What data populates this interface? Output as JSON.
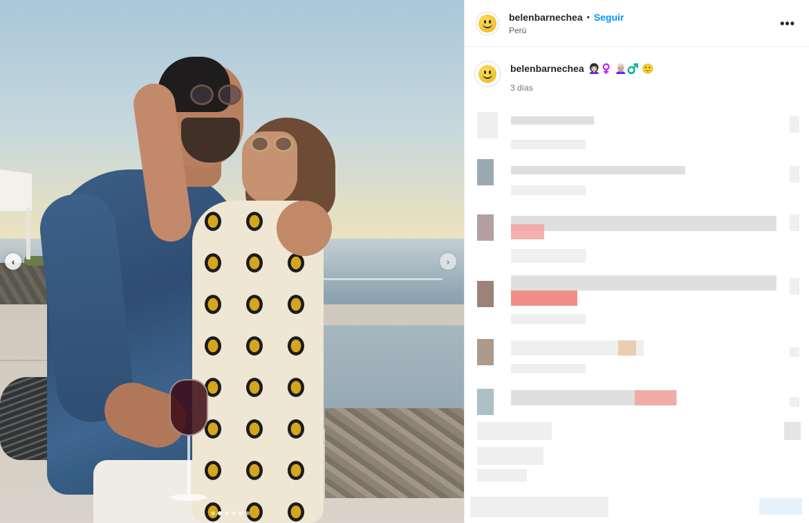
{
  "post": {
    "username": "belenbarnechea",
    "follow_label": "Seguir",
    "separator": "•",
    "location": "Perú",
    "more_label": "•••",
    "avatar_icon": "smiley-icon"
  },
  "caption": {
    "username": "belenbarnechea",
    "emojis": "👩🏻‍🦱♀️ 👩🏼‍🦳♂️ 🙂",
    "time": "3 días"
  },
  "carousel": {
    "prev_icon": "chevron-left-icon",
    "next_icon": "chevron-right-icon",
    "prev_glyph": "‹",
    "next_glyph": "›",
    "dots": 6,
    "active_dot": 1
  },
  "colors": {
    "link_blue": "#0095f6",
    "text": "#262626",
    "muted": "#737373"
  }
}
